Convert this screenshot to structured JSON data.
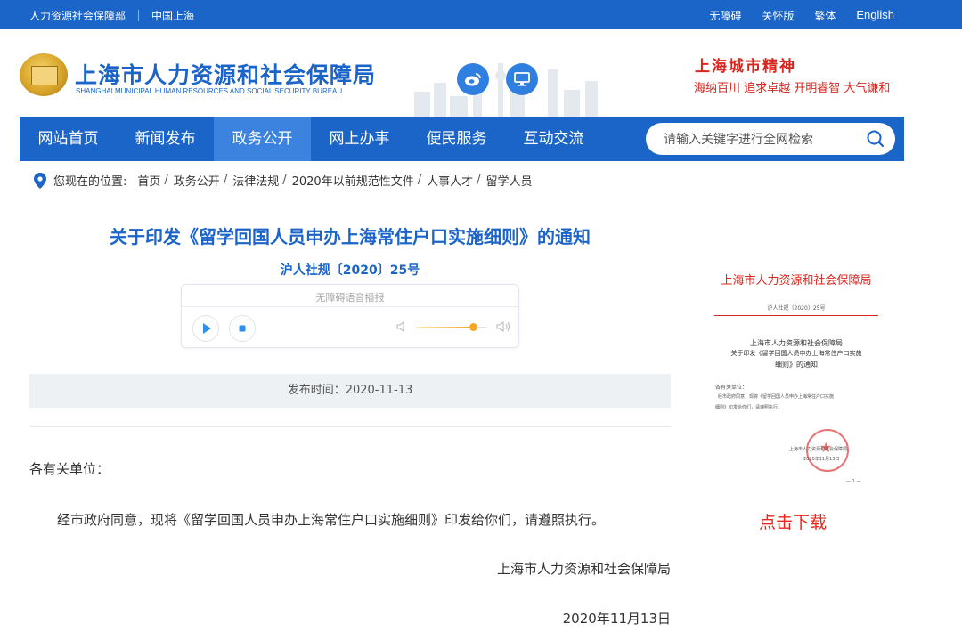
{
  "topbar": {
    "bureau_link": "人力资源社会保障部",
    "shanghai_link": "中国上海",
    "accessibility": "无障碍",
    "elder_mode": "关怀版",
    "traditional": "繁体",
    "english": "English"
  },
  "header": {
    "title": "上海市人力资源和社会保障局",
    "subtitle": "SHANGHAI MUNICIPAL HUMAN RESOURCES AND SOCIAL SECURITY BUREAU",
    "icons": [
      "weibo-icon",
      "screen-icon"
    ],
    "spirit_title": "上海城市精神",
    "spirit_text": "海纳百川 追求卓越 开明睿智 大气谦和"
  },
  "nav": {
    "items": [
      {
        "label": "网站首页",
        "active": false
      },
      {
        "label": "新闻发布",
        "active": false
      },
      {
        "label": "政务公开",
        "active": true
      },
      {
        "label": "网上办事",
        "active": false
      },
      {
        "label": "便民服务",
        "active": false
      },
      {
        "label": "互动交流",
        "active": false
      }
    ],
    "search_placeholder": "请输入关键字进行全网检索"
  },
  "breadcrumb": {
    "prefix": "您现在的位置:",
    "items": [
      "首页",
      "政务公开",
      "法律法规",
      "2020年以前规范性文件",
      "人事人才",
      "留学人员"
    ]
  },
  "article": {
    "title": "关于印发《留学回国人员申办上海常住户口实施细则》的通知",
    "doc_no": "沪人社规〔2020〕25号",
    "player_caption": "无障碍语音播报",
    "volume_level": 0.8,
    "publish_time": "发布时间：2020-11-13",
    "salutation": "各有关单位：",
    "body": "经市政府同意，现将《留学回国人员申办上海常住户口实施细则》印发给你们，请遵照执行。",
    "sign_org": "上海市人力资源和社会保障局",
    "sign_date": "2020年11月13日"
  },
  "preview": {
    "head": "上海市人力资源和社会保障局",
    "doc_no": "沪人社规〔2020〕25号",
    "t1": "上海市人力资源和社会保障局",
    "t2": "关于印发《留学回国人员申办上海常住户口实施",
    "t3": "细则》的通知",
    "s1": "各有关单位：",
    "s2": "经市政府同意，现将《留学回国人员申办上海常住户口实施",
    "s3": "细则》印发给你们，请遵照执行。",
    "sign": "上海市人力资源和社会保障局",
    "date": "2020年11月13日",
    "page": "— 1 —",
    "download": "点击下载"
  }
}
